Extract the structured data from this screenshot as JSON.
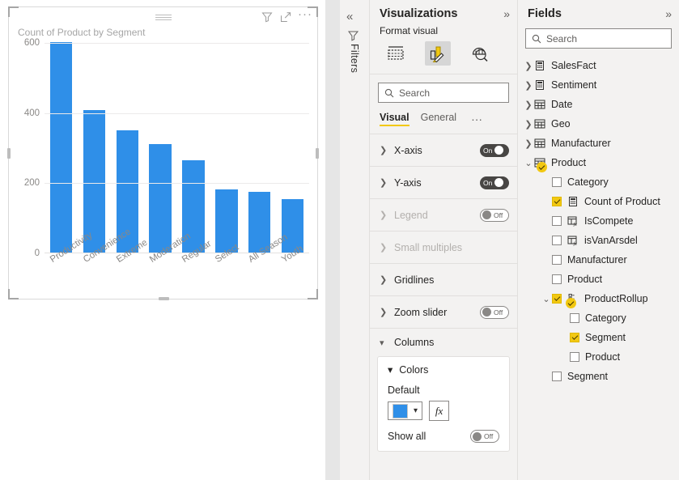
{
  "canvas": {
    "visual_title": "Count of Product by Segment",
    "header_icons": [
      {
        "name": "filter-icon",
        "label": "Filters"
      },
      {
        "name": "focus-mode-icon",
        "label": "Focus mode"
      },
      {
        "name": "more-options-icon",
        "label": "More options"
      }
    ]
  },
  "chart_data": {
    "type": "bar",
    "title": "Count of Product by Segment",
    "categories": [
      "Productivity",
      "Convenience",
      "Extreme",
      "Moderation",
      "Regular",
      "Select",
      "All Season",
      "Youth"
    ],
    "values": [
      601,
      406,
      348,
      310,
      262,
      180,
      172,
      152
    ],
    "xlabel": "",
    "ylabel": "",
    "ylim": [
      0,
      600
    ],
    "yticks": [
      0,
      200,
      400,
      600
    ],
    "ytick_labels": [
      "0",
      "200",
      "400",
      "600"
    ],
    "grid": true,
    "legend": false,
    "bar_color": "#2f8fe8",
    "axis_text_color": "#8a8886"
  },
  "rail": {
    "collapse_label": "«",
    "filter_icon": "filter-icon",
    "filters_label": "Filters"
  },
  "visualizations": {
    "title": "Visualizations",
    "expand_chevron": "»",
    "format_label": "Format visual",
    "icon_tabs": [
      {
        "name": "build-visual-icon",
        "label": "Build visual",
        "selected": false
      },
      {
        "name": "format-visual-icon",
        "label": "Format visual",
        "selected": true
      },
      {
        "name": "analytics-icon",
        "label": "Analytics",
        "selected": false
      }
    ],
    "search": {
      "placeholder": "Search",
      "value": ""
    },
    "tabs": [
      {
        "label": "Visual",
        "active": true
      },
      {
        "label": "General",
        "active": false
      }
    ],
    "tab_overflow": "···",
    "format_rows": [
      {
        "label": "X-axis",
        "expanded": false,
        "toggle": "On",
        "disabled": false,
        "has_toggle": true
      },
      {
        "label": "Y-axis",
        "expanded": false,
        "toggle": "On",
        "disabled": false,
        "has_toggle": true
      },
      {
        "label": "Legend",
        "expanded": false,
        "toggle": "Off",
        "disabled": true,
        "has_toggle": true
      },
      {
        "label": "Small multiples",
        "expanded": false,
        "toggle": "",
        "disabled": true,
        "has_toggle": false
      },
      {
        "label": "Gridlines",
        "expanded": false,
        "toggle": "",
        "disabled": false,
        "has_toggle": false
      },
      {
        "label": "Zoom slider",
        "expanded": false,
        "toggle": "Off",
        "disabled": false,
        "has_toggle": true
      }
    ],
    "columns_section": {
      "label": "Columns",
      "expanded": true,
      "colors_label": "Colors",
      "default_label": "Default",
      "default_color": "#2f8fe8",
      "fx_label": "fx",
      "show_all_label": "Show all",
      "show_all_toggle": "Off"
    }
  },
  "fields": {
    "title": "Fields",
    "expand_chevron": "»",
    "search": {
      "placeholder": "Search",
      "value": ""
    },
    "tree": [
      {
        "label": "SalesFact",
        "indent": 0,
        "expander": "›",
        "icon": "measure-table-icon",
        "checkbox": null,
        "badge": false
      },
      {
        "label": "Sentiment",
        "indent": 0,
        "expander": "›",
        "icon": "measure-table-icon",
        "checkbox": null,
        "badge": false
      },
      {
        "label": "Date",
        "indent": 0,
        "expander": "›",
        "icon": "table-icon",
        "checkbox": null,
        "badge": false
      },
      {
        "label": "Geo",
        "indent": 0,
        "expander": "›",
        "icon": "table-icon",
        "checkbox": null,
        "badge": false
      },
      {
        "label": "Manufacturer",
        "indent": 0,
        "expander": "›",
        "icon": "table-icon",
        "checkbox": null,
        "badge": false
      },
      {
        "label": "Product",
        "indent": 0,
        "expander": "˅",
        "icon": "table-icon",
        "checkbox": null,
        "badge": true
      },
      {
        "label": "Category",
        "indent": 1,
        "expander": "",
        "icon": "none",
        "checkbox": false,
        "badge": false
      },
      {
        "label": "Count of Product",
        "indent": 1,
        "expander": "",
        "icon": "measure-icon",
        "checkbox": true,
        "badge": false
      },
      {
        "label": "IsCompete",
        "indent": 1,
        "expander": "",
        "icon": "calc-column-icon",
        "checkbox": false,
        "badge": false
      },
      {
        "label": "isVanArsdel",
        "indent": 1,
        "expander": "",
        "icon": "calc-column-icon",
        "checkbox": false,
        "badge": false
      },
      {
        "label": "Manufacturer",
        "indent": 1,
        "expander": "",
        "icon": "none",
        "checkbox": false,
        "badge": false
      },
      {
        "label": "Product",
        "indent": 1,
        "expander": "",
        "icon": "none",
        "checkbox": false,
        "badge": false
      },
      {
        "label": "ProductRollup",
        "indent": 1,
        "expander": "˅",
        "icon": "hierarchy-icon",
        "checkbox": true,
        "badge": true
      },
      {
        "label": "Category",
        "indent": 2,
        "expander": "",
        "icon": "none",
        "checkbox": false,
        "badge": false
      },
      {
        "label": "Segment",
        "indent": 2,
        "expander": "",
        "icon": "none",
        "checkbox": true,
        "badge": false
      },
      {
        "label": "Product",
        "indent": 2,
        "expander": "",
        "icon": "none",
        "checkbox": false,
        "badge": false
      },
      {
        "label": "Segment",
        "indent": 1,
        "expander": "",
        "icon": "none",
        "checkbox": false,
        "badge": false
      }
    ]
  }
}
